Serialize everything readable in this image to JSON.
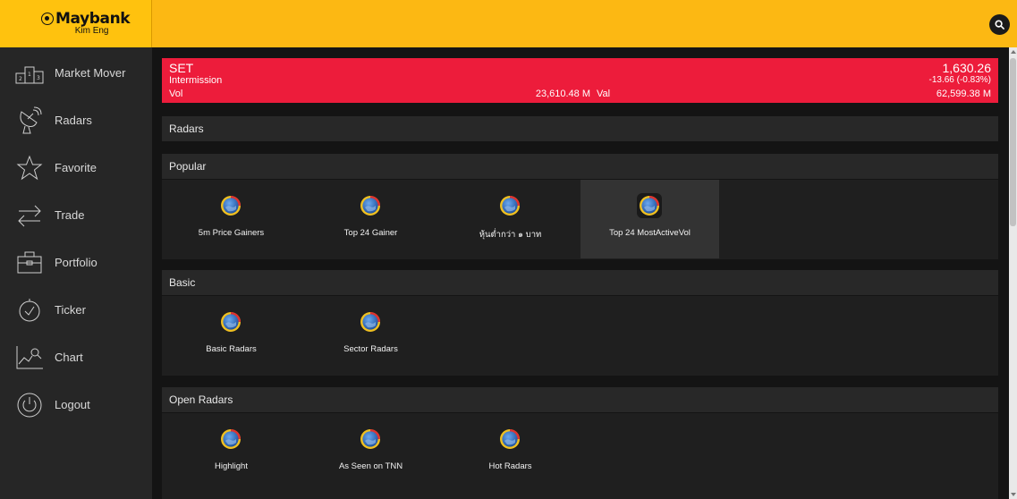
{
  "brand": {
    "name": "Maybank",
    "sub": "Kim Eng"
  },
  "header": {
    "search_icon": "search-icon"
  },
  "sidebar": {
    "items": [
      {
        "label": "Market Mover",
        "icon": "podium-icon"
      },
      {
        "label": "Radars",
        "icon": "satellite-dish-icon"
      },
      {
        "label": "Favorite",
        "icon": "star-icon"
      },
      {
        "label": "Trade",
        "icon": "swap-arrows-icon"
      },
      {
        "label": "Portfolio",
        "icon": "briefcase-icon"
      },
      {
        "label": "Ticker",
        "icon": "stopwatch-icon"
      },
      {
        "label": "Chart",
        "icon": "line-chart-icon"
      },
      {
        "label": "Logout",
        "icon": "power-icon"
      }
    ]
  },
  "index": {
    "name": "SET",
    "status": "Intermission",
    "vol_label": "Vol",
    "vol_value": "23,610.48 M",
    "val_label": "Val",
    "price": "1,630.26",
    "change": "-13.66  (-0.83%)",
    "val_value": "62,599.38 M",
    "color": "#ed1c3b"
  },
  "title": "Radars",
  "sections": [
    {
      "title": "Popular",
      "items": [
        "5m Price Gainers",
        "Top 24 Gainer",
        "หุ้นต่ำกว่า ๑ บาท",
        "Top 24 MostActiveVol"
      ],
      "active_index": 3
    },
    {
      "title": "Basic",
      "items": [
        "Basic Radars",
        "Sector Radars"
      ]
    },
    {
      "title": "Open Radars",
      "items": [
        "Highlight",
        "As Seen on TNN",
        "Hot Radars"
      ]
    }
  ],
  "colors": {
    "accent": "#fcb813",
    "sidebar": "#262626",
    "background": "#141414"
  }
}
